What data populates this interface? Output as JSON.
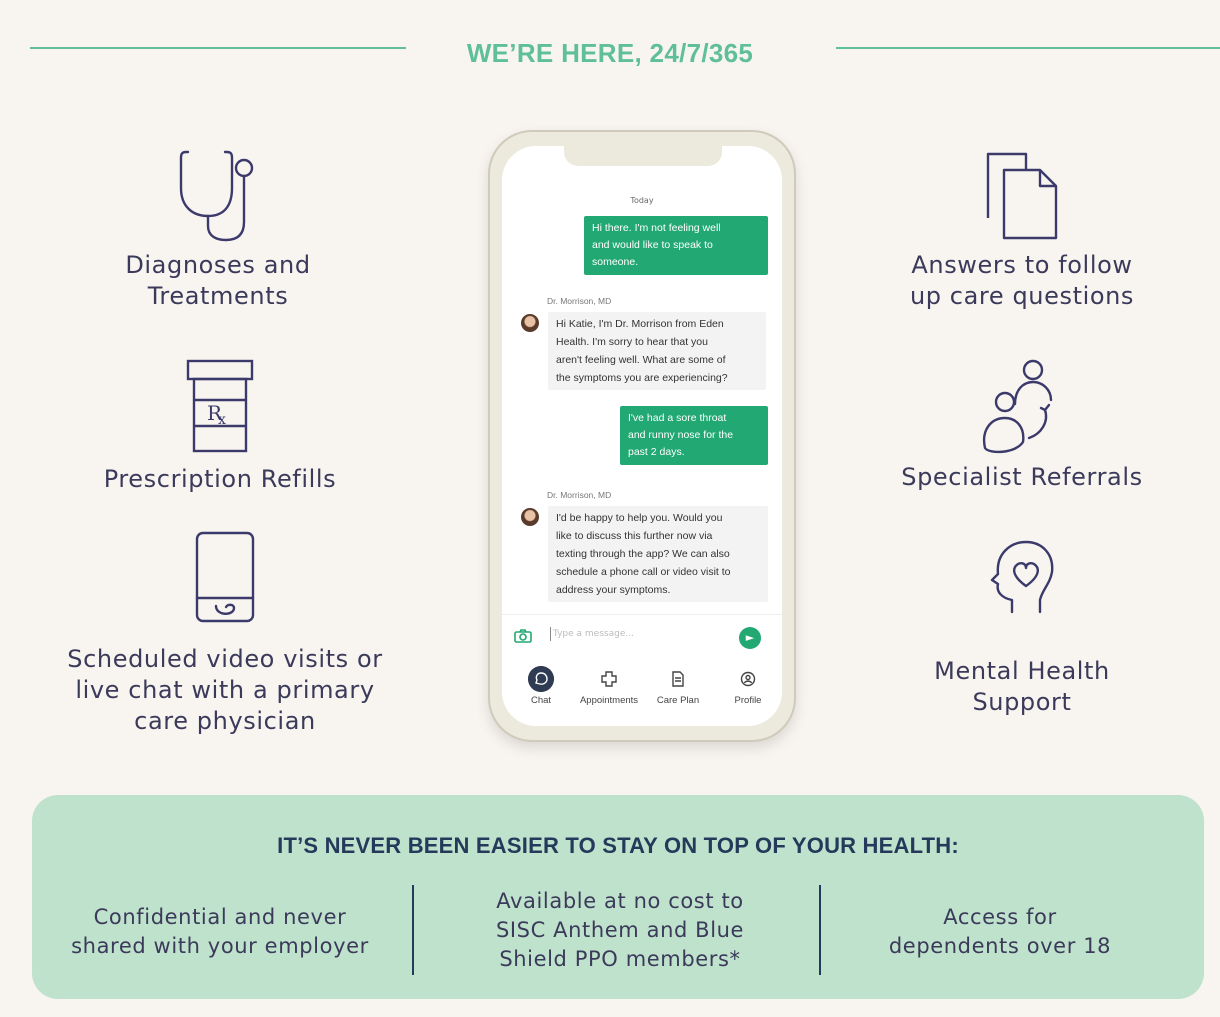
{
  "header": {
    "title": "WE’RE HERE, 24/7/365"
  },
  "features_left": [
    {
      "icon": "stethoscope-icon",
      "label_lines": [
        "Diagnoses and",
        "Treatments"
      ]
    },
    {
      "icon": "prescription-bottle-icon",
      "label_lines": [
        "Prescription Refills"
      ]
    },
    {
      "icon": "phone-video-icon",
      "label_lines": [
        "Scheduled video visits or",
        "live chat with a primary",
        "care physician"
      ]
    }
  ],
  "features_right": [
    {
      "icon": "documents-icon",
      "label_lines": [
        "Answers to follow",
        "up care questions"
      ]
    },
    {
      "icon": "referral-people-icon",
      "label_lines": [
        "Specialist Referrals"
      ]
    },
    {
      "icon": "head-heart-icon",
      "label_lines": [
        "Mental Health",
        "Support"
      ]
    }
  ],
  "phone": {
    "date_label": "Today",
    "messages": [
      {
        "from": "user",
        "lines": [
          "Hi there. I'm not feeling well",
          "and would like to speak to",
          "someone."
        ]
      },
      {
        "from": "doctor",
        "sender": "Dr. Morrison, MD",
        "lines": [
          "Hi Katie, I'm Dr. Morrison from Eden",
          "Health. I'm sorry to hear that you",
          "aren't feeling well. What are some of",
          "the symptoms you are experiencing?"
        ]
      },
      {
        "from": "user",
        "lines": [
          "I've had a sore throat",
          "and runny nose for the",
          "past 2 days."
        ]
      },
      {
        "from": "doctor",
        "sender": "Dr. Morrison, MD",
        "lines": [
          "I'd be happy to help you. Would you",
          "like to discuss this further now via",
          "texting through the app? We can also",
          "schedule a phone call or video visit to",
          "address your symptoms."
        ]
      }
    ],
    "input_placeholder": "Type a message...",
    "tabs": [
      {
        "label": "Chat",
        "icon": "chat-icon",
        "active": true
      },
      {
        "label": "Appointments",
        "icon": "plus-cross-icon",
        "active": false
      },
      {
        "label": "Care Plan",
        "icon": "document-icon",
        "active": false
      },
      {
        "label": "Profile",
        "icon": "profile-icon",
        "active": false
      }
    ]
  },
  "panel": {
    "title": "IT’S NEVER BEEN EASIER TO STAY ON TOP OF YOUR HEALTH:",
    "columns": [
      {
        "lines": [
          "Confidential and never",
          "shared with your employer"
        ]
      },
      {
        "lines": [
          "Available at no cost to",
          "SISC Anthem and Blue",
          "Shield PPO members*"
        ]
      },
      {
        "lines": [
          "Access for",
          "dependents over 18"
        ]
      }
    ]
  },
  "colors": {
    "accent_green": "#5fbf98",
    "bubble_green": "#22a872",
    "navy": "#253a5a",
    "icon_purple": "#3b3a6b",
    "panel_bg": "#bfe2cc",
    "page_bg": "#f8f5f0"
  }
}
